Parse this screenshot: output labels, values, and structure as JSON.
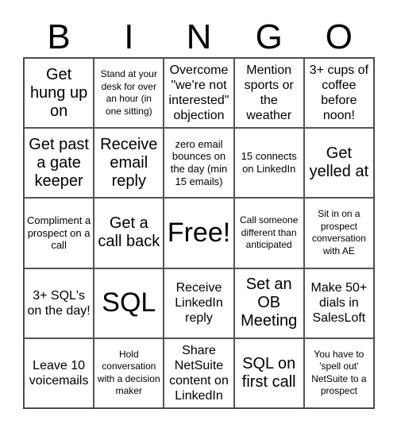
{
  "header": {
    "letters": [
      "B",
      "I",
      "N",
      "G",
      "O"
    ]
  },
  "board": {
    "rows": [
      [
        {
          "text": "Get hung up on",
          "size": "lg"
        },
        {
          "text": "Stand at your desk for over an hour (in one sitting)",
          "size": "xs"
        },
        {
          "text": "Overcome \"we're not interested\" objection",
          "size": "md"
        },
        {
          "text": "Mention sports or the weather",
          "size": "md"
        },
        {
          "text": "3+ cups of coffee before noon!",
          "size": "md"
        }
      ],
      [
        {
          "text": "Get past a gate keeper",
          "size": "lg"
        },
        {
          "text": "Receive email reply",
          "size": "lg"
        },
        {
          "text": "zero email bounces on the day (min 15 emails)",
          "size": "sm"
        },
        {
          "text": "15 connects on LinkedIn",
          "size": "sm"
        },
        {
          "text": "Get yelled at",
          "size": "lg"
        }
      ],
      [
        {
          "text": "Compliment a prospect on a call",
          "size": "sm"
        },
        {
          "text": "Get a call back",
          "size": "lg"
        },
        {
          "text": "Free!",
          "size": "xl"
        },
        {
          "text": "Call someone different than anticipated",
          "size": "xs"
        },
        {
          "text": "Sit in on a prospect conversation with AE",
          "size": "xs"
        }
      ],
      [
        {
          "text": "3+ SQL's on the day!",
          "size": "md"
        },
        {
          "text": "SQL",
          "size": "xl"
        },
        {
          "text": "Receive LinkedIn reply",
          "size": "md"
        },
        {
          "text": "Set an OB Meeting",
          "size": "lg"
        },
        {
          "text": "Make 50+ dials in SalesLoft",
          "size": "md"
        }
      ],
      [
        {
          "text": "Leave 10 voicemails",
          "size": "md"
        },
        {
          "text": "Hold conversation with a decision maker",
          "size": "xs"
        },
        {
          "text": "Share NetSuite content on LinkedIn",
          "size": "md"
        },
        {
          "text": "SQL on first call",
          "size": "lg"
        },
        {
          "text": "You have to 'spell out' NetSuite to a prospect",
          "size": "xs"
        }
      ]
    ]
  },
  "colors": {
    "background": "#ffffff",
    "text": "#000000",
    "grid_border": "#555555"
  }
}
